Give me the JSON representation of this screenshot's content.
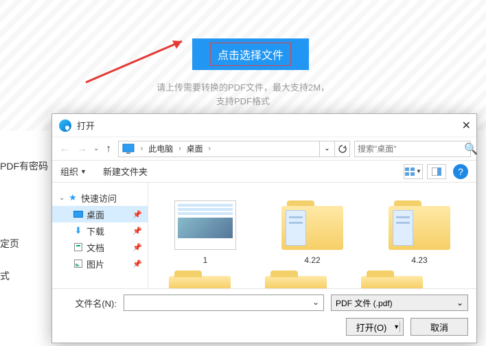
{
  "main_button": "点击选择文件",
  "hint": "请上传需要转换的PDF文件，最大支持2M，\n支持PDF格式",
  "sidebar_fragments": {
    "t1": "PDF有密码",
    "t2": "定页",
    "t3": "式"
  },
  "dialog": {
    "title": "打开",
    "breadcrumb": {
      "root": "此电脑",
      "current": "桌面"
    },
    "search_placeholder": "搜索\"桌面\"",
    "toolbar": {
      "organize": "组织",
      "new_folder": "新建文件夹"
    },
    "tree": {
      "quick_access": "快速访问",
      "items": [
        {
          "label": "桌面",
          "selected": true
        },
        {
          "label": "下载",
          "selected": false
        },
        {
          "label": "文档",
          "selected": false
        },
        {
          "label": "图片",
          "selected": false
        }
      ]
    },
    "files": [
      {
        "name": "1",
        "type": "doc"
      },
      {
        "name": "4.22",
        "type": "folder"
      },
      {
        "name": "4.23",
        "type": "folder"
      }
    ],
    "filename_label": "文件名(N):",
    "filetype": "PDF 文件 (.pdf)",
    "open_btn": "打开(O)",
    "cancel_btn": "取消"
  }
}
